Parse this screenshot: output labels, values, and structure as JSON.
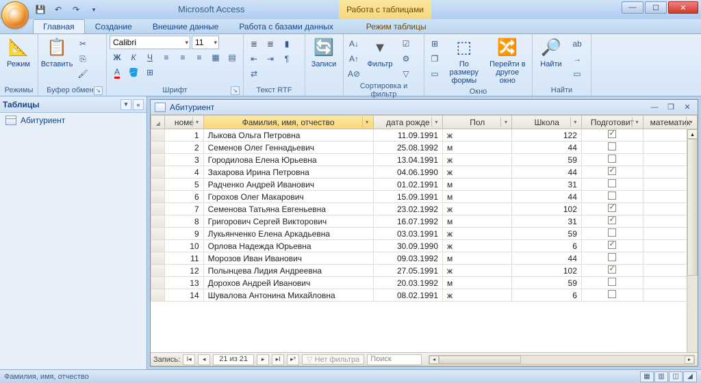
{
  "app_title": "Microsoft Access",
  "context_tab_title": "Работа с таблицами",
  "tabs": {
    "home": "Главная",
    "create": "Создание",
    "external": "Внешние данные",
    "dbtools": "Работа с базами данных",
    "datasheet": "Режим таблицы"
  },
  "ribbon": {
    "views": {
      "label": "Режимы",
      "btn": "Режим"
    },
    "clipboard": {
      "label": "Буфер обмена",
      "paste": "Вставить"
    },
    "font": {
      "label": "Шрифт",
      "name": "Calibri",
      "size": "11"
    },
    "richtext": {
      "label": "Текст RTF"
    },
    "records": {
      "label": "Записи",
      "btn": "Записи"
    },
    "sortfilter": {
      "label": "Сортировка и фильтр",
      "filter": "Фильтр"
    },
    "window": {
      "label": "Окно",
      "fit": "По размеру формы",
      "switch": "Перейти в другое окно"
    },
    "find": {
      "label": "Найти",
      "btn": "Найти"
    }
  },
  "nav": {
    "header": "Таблицы",
    "items": [
      "Абитуриент"
    ]
  },
  "doc": {
    "title": "Абитуриент"
  },
  "columns": {
    "rowsel": "",
    "num": "номе",
    "fio": "Фамилия, имя, отчество",
    "dob": "дата рожде",
    "sex": "Пол",
    "school": "Школа",
    "prep": "Подготовит",
    "math": "математик"
  },
  "rows": [
    {
      "n": 1,
      "fio": "Лыкова Ольга Петровна",
      "dob": "11.09.1991",
      "sex": "ж",
      "school": 122,
      "prep": true
    },
    {
      "n": 2,
      "fio": "Семенов Олег Геннадьевич",
      "dob": "25.08.1992",
      "sex": "м",
      "school": 44,
      "prep": false
    },
    {
      "n": 3,
      "fio": "Городилова Елена Юрьевна",
      "dob": "13.04.1991",
      "sex": "ж",
      "school": 59,
      "prep": false
    },
    {
      "n": 4,
      "fio": "Захарова Ирина Петровна",
      "dob": "04.06.1990",
      "sex": "ж",
      "school": 44,
      "prep": true
    },
    {
      "n": 5,
      "fio": "Радченко Андрей Иванович",
      "dob": "01.02.1991",
      "sex": "м",
      "school": 31,
      "prep": false
    },
    {
      "n": 6,
      "fio": "Горохов Олег Макарович",
      "dob": "15.09.1991",
      "sex": "м",
      "school": 44,
      "prep": false
    },
    {
      "n": 7,
      "fio": "Семенова Татьяна Евгеньевна",
      "dob": "23.02.1992",
      "sex": "ж",
      "school": 102,
      "prep": true
    },
    {
      "n": 8,
      "fio": "Григорович Сергей Викторович",
      "dob": "16.07.1992",
      "sex": "м",
      "school": 31,
      "prep": true
    },
    {
      "n": 9,
      "fio": "Лукьянченко Елена Аркадьевна",
      "dob": "03.03.1991",
      "sex": "ж",
      "school": 59,
      "prep": false
    },
    {
      "n": 10,
      "fio": "Орлова Надежда Юрьевна",
      "dob": "30.09.1990",
      "sex": "ж",
      "school": 6,
      "prep": true
    },
    {
      "n": 11,
      "fio": "Морозов Иван Иванович",
      "dob": "09.03.1992",
      "sex": "м",
      "school": 44,
      "prep": false
    },
    {
      "n": 12,
      "fio": "Полынцева Лидия Андреевна",
      "dob": "27.05.1991",
      "sex": "ж",
      "school": 102,
      "prep": true
    },
    {
      "n": 13,
      "fio": "Дорохов Андрей Иванович",
      "dob": "20.03.1992",
      "sex": "м",
      "school": 59,
      "prep": false
    },
    {
      "n": 14,
      "fio": "Шувалова Антонина Михайловна",
      "dob": "08.02.1991",
      "sex": "ж",
      "school": 6,
      "prep": false
    }
  ],
  "recordnav": {
    "label": "Запись:",
    "pos": "21 из 21",
    "nofilter": "Нет фильтра",
    "search": "Поиск"
  },
  "statusbar": "Фамилия, имя, отчество"
}
